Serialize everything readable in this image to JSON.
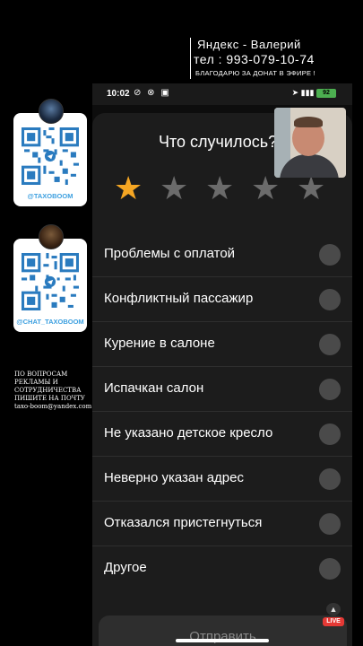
{
  "overlay": {
    "line1": "Яндекс - Валерий",
    "line2": "тел : 993-079-10-74",
    "line3": "БЛАГОДАРЮ ЗА ДОНАТ В ЭФИРЕ !"
  },
  "qr_cards": [
    {
      "handle": "@TAXOBOOM"
    },
    {
      "handle": "@CHAT_TAXOBOOM"
    }
  ],
  "ad_text": {
    "l1": "ПО ВОПРОСАМ",
    "l2": "РЕКЛАМЫ И",
    "l3": "СОТРУДНИЧЕСТВА",
    "l4": "ПИШИТЕ НА ПОЧТУ",
    "l5": "taxo-boom@yandex.com"
  },
  "status_bar": {
    "time": "10:02",
    "battery": "92"
  },
  "dialog": {
    "title": "Что случилось?",
    "rating": {
      "value": 1,
      "max": 5
    },
    "options": [
      "Проблемы с оплатой",
      "Конфликтный пассажир",
      "Курение в салоне",
      "Испачкан салон",
      "Не указано детское кресло",
      "Неверно указан адрес",
      "Отказался пристегнуться",
      "Другое"
    ],
    "submit_label": "Отправить"
  },
  "live_badge": "LIVE",
  "colors": {
    "star_active": "#f5a623",
    "star_inactive": "#6b6b6b",
    "qr_handle": "#3da0e0",
    "live": "#e53935"
  }
}
